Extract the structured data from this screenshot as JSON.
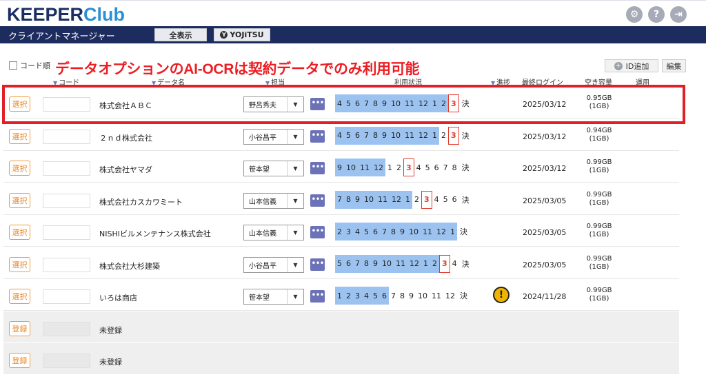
{
  "header": {
    "logo_main": "KEEPER",
    "logo_accent": "Club",
    "icons": [
      "user-gear-icon",
      "help-icon",
      "logout-icon"
    ],
    "icon_glyphs": {
      "help": "?",
      "user": "⚙",
      "logout": "⇥"
    }
  },
  "nav": {
    "title": "クライアントマネージャー",
    "show_all": "全表示",
    "brand": "YOJiTSU",
    "brand_glyph": "Y"
  },
  "controls": {
    "code_order": "コード順",
    "banner": "データオプションのAI-OCRは契約データでのみ利用可能",
    "add_id": "ID追加",
    "add_glyph": "+",
    "edit": "編集"
  },
  "columns": {
    "code": "コード",
    "data_name": "データ名",
    "person": "担当",
    "usage": "利用状況",
    "progress": "進捗",
    "last_login": "最終ログイン",
    "free_space": "空き容量",
    "operation": "運用"
  },
  "ketsu": "決",
  "warn_glyph": "!",
  "rows": [
    {
      "select": "選択",
      "name": "株式会社ＡＢＣ",
      "person": "野呂秀夫",
      "months": [
        "4",
        "5",
        "6",
        "7",
        "8",
        "9",
        "10",
        "11",
        "12",
        "1",
        "2"
      ],
      "current": "3",
      "trailing": [],
      "warn": false,
      "login": "2025/03/12",
      "cap": "0.95GB",
      "cap_total": "(1GB)"
    },
    {
      "select": "選択",
      "name": "２ｎｄ株式会社",
      "person": "小谷昌平",
      "months": [
        "4",
        "5",
        "6",
        "7",
        "8",
        "9",
        "10",
        "11",
        "12",
        "1"
      ],
      "plain": [
        "2"
      ],
      "current": "3",
      "trailing": [],
      "warn": false,
      "login": "2025/03/12",
      "cap": "0.94GB",
      "cap_total": "(1GB)"
    },
    {
      "select": "選択",
      "name": "株式会社ヤマダ",
      "person": "笹本望",
      "months": [
        "9",
        "10",
        "11",
        "12"
      ],
      "plain": [
        "1",
        "2"
      ],
      "current": "3",
      "trailing": [
        "4",
        "5",
        "6",
        "7",
        "8"
      ],
      "warn": false,
      "login": "2025/03/12",
      "cap": "0.99GB",
      "cap_total": "(1GB)"
    },
    {
      "select": "選択",
      "name": "株式会社カスカワミート",
      "person": "山本信義",
      "months": [
        "7",
        "8",
        "9",
        "10",
        "11",
        "12",
        "1"
      ],
      "plain": [
        "2"
      ],
      "current": "3",
      "trailing": [
        "4",
        "5",
        "6"
      ],
      "warn": false,
      "login": "2025/03/05",
      "cap": "0.99GB",
      "cap_total": "(1GB)"
    },
    {
      "select": "選択",
      "name": "NISHIビルメンテナンス株式会社",
      "person": "山本信義",
      "months": [
        "2",
        "3",
        "4",
        "5",
        "6",
        "7",
        "8",
        "9",
        "10",
        "11",
        "12",
        "1"
      ],
      "plain": [],
      "current": "",
      "trailing": [],
      "warn": false,
      "login": "2025/03/05",
      "cap": "0.99GB",
      "cap_total": "(1GB)"
    },
    {
      "select": "選択",
      "name": "株式会社大杉建築",
      "person": "小谷昌平",
      "months": [
        "5",
        "6",
        "7",
        "8",
        "9",
        "10",
        "11",
        "12",
        "1",
        "2"
      ],
      "plain": [],
      "current": "3",
      "trailing": [
        "4"
      ],
      "warn": false,
      "login": "2025/03/05",
      "cap": "0.99GB",
      "cap_total": "(1GB)"
    },
    {
      "select": "選択",
      "name": "いろは商店",
      "person": "笹本望",
      "months": [
        "1",
        "2",
        "3",
        "4",
        "5",
        "6"
      ],
      "plain": [
        "7",
        "8",
        "9",
        "10",
        "11",
        "12"
      ],
      "current": "",
      "trailing": [],
      "warn": true,
      "login": "2024/11/28",
      "cap": "0.99GB",
      "cap_total": "(1GB)"
    }
  ],
  "unregistered": [
    {
      "select": "登録",
      "name": "未登録"
    },
    {
      "select": "登録",
      "name": "未登録"
    }
  ],
  "colors": {
    "navy": "#1d2c5e",
    "accent_red": "#ec1d23",
    "usage_blue": "#9cc2f0",
    "select_orange": "#e98a2b"
  }
}
